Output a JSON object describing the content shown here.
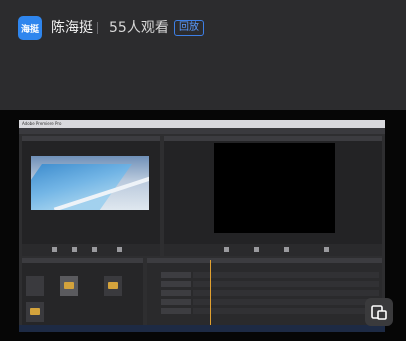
{
  "header": {
    "avatar_text": "海挺",
    "streamer_name": "陈海挺",
    "separator": "|",
    "viewers": "55人观看",
    "replay_badge": "回放"
  },
  "video": {
    "app_title": "Adobe Premiere Pro"
  },
  "colors": {
    "accent": "#2f86ee",
    "header_bg": "#2c2c2e",
    "video_bg": "#060606"
  },
  "icons": {
    "overlay_button": "pip-icon"
  }
}
